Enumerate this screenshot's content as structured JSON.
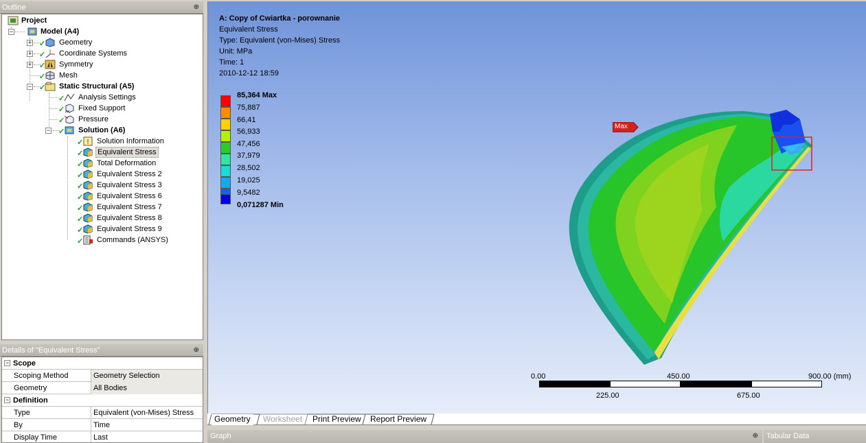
{
  "outline": {
    "title": "Outline",
    "items": [
      {
        "label": "Project",
        "bold": true
      },
      {
        "label": "Model (A4)",
        "bold": true
      },
      {
        "label": "Geometry"
      },
      {
        "label": "Coordinate Systems"
      },
      {
        "label": "Symmetry"
      },
      {
        "label": "Mesh"
      },
      {
        "label": "Static Structural (A5)",
        "bold": true
      },
      {
        "label": "Analysis Settings"
      },
      {
        "label": "Fixed Support"
      },
      {
        "label": "Pressure"
      },
      {
        "label": "Solution (A6)",
        "bold": true
      },
      {
        "label": "Solution Information"
      },
      {
        "label": "Equivalent Stress",
        "selected": true
      },
      {
        "label": "Total Deformation"
      },
      {
        "label": "Equivalent Stress 2"
      },
      {
        "label": "Equivalent Stress 3"
      },
      {
        "label": "Equivalent Stress 6"
      },
      {
        "label": "Equivalent Stress 7"
      },
      {
        "label": "Equivalent Stress 8"
      },
      {
        "label": "Equivalent Stress 9"
      },
      {
        "label": "Commands (ANSYS)"
      }
    ]
  },
  "details": {
    "title": "Details of \"Equivalent Stress\"",
    "groups": [
      {
        "name": "Scope",
        "rows": [
          {
            "key": "Scoping Method",
            "value": "Geometry Selection"
          },
          {
            "key": "Geometry",
            "value": "All Bodies"
          }
        ]
      },
      {
        "name": "Definition",
        "rows": [
          {
            "key": "Type",
            "value": "Equivalent (von-Mises) Stress"
          },
          {
            "key": "By",
            "value": "Time"
          },
          {
            "key": "Display Time",
            "value": "Last"
          }
        ]
      }
    ]
  },
  "viewport": {
    "header": {
      "title": "A: Copy of Cwiartka - porownanie",
      "result": "Equivalent Stress",
      "type": "Type: Equivalent (von-Mises) Stress",
      "unit": "Unit: MPa",
      "time": "Time: 1",
      "date": "2010-12-12 18:59"
    },
    "legend": [
      {
        "label": "85,364 Max",
        "color": "#ff0000"
      },
      {
        "label": "75,887",
        "color": "#ff8c00"
      },
      {
        "label": "66,41",
        "color": "#ffd200"
      },
      {
        "label": "56,933",
        "color": "#b4f000"
      },
      {
        "label": "47,456",
        "color": "#2ecb2e"
      },
      {
        "label": "37,979",
        "color": "#2ee6a0"
      },
      {
        "label": "28,502",
        "color": "#20d8d8"
      },
      {
        "label": "19,025",
        "color": "#18a8f0"
      },
      {
        "label": "9,5482",
        "color": "#1860f0"
      },
      {
        "label": "0,071287 Min",
        "color": "#0000e6"
      }
    ],
    "max_tag": "Max",
    "scale": {
      "top": [
        "0.00",
        "450.00",
        "900.00 (mm)"
      ],
      "bottom": [
        "225.00",
        "675.00"
      ]
    }
  },
  "tabs": [
    "Geometry",
    "Worksheet",
    "Print Preview",
    "Report Preview"
  ],
  "bottom": {
    "graph": "Graph",
    "tabular": "Tabular Data"
  }
}
